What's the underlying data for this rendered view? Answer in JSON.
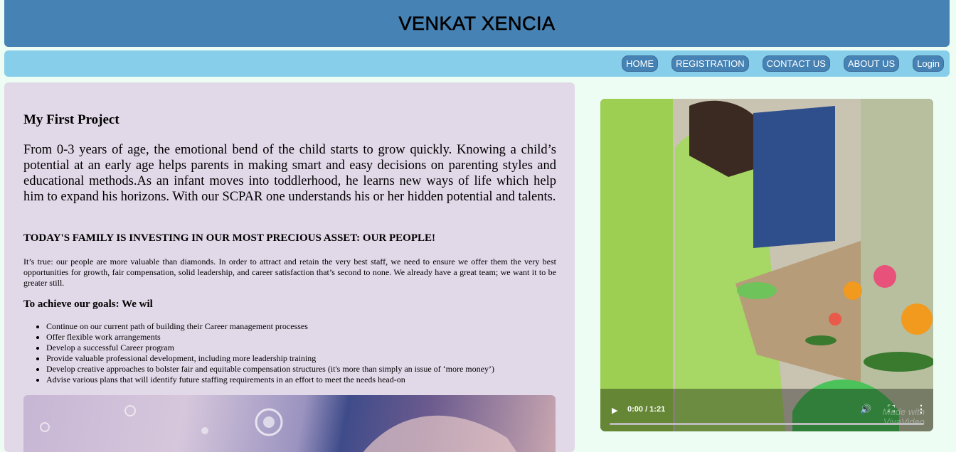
{
  "header": {
    "title": "VENKAT XENCIA"
  },
  "nav": {
    "items": [
      "HOME",
      "REGISTRATION",
      "CONTACT US",
      "ABOUT US",
      "Login"
    ]
  },
  "main": {
    "title": "My First Project",
    "intro": "From 0-3 years of age, the emotional bend of the child starts to grow quickly. Knowing a child’s potential at an early age helps parents in making smart and easy decisions on parenting styles and educational methods.As an infant moves into toddlerhood, he learns new ways of life which help him to expand his horizons. With our SCPAR one understands his or her hidden potential and talents.",
    "subheading": "TODAY'S FAMILY IS INVESTING IN OUR MOST PRECIOUS ASSET: OUR PEOPLE!",
    "paragraph": "It’s true: our people are more valuable than diamonds. In order to attract and retain the very best staff, we need to ensure we offer them the very best opportunities for growth, fair compensation, solid leadership, and career satisfaction that’s second to none. We already have a great team; we want it to be greater still.",
    "goals_heading": "To achieve our goals: We wil",
    "goals": [
      "Continue on our current path of building their Career management processes",
      "Offer flexible work arrangements",
      "Develop a successful Career program",
      "Provide valuable professional development, including more leadership training",
      "Develop creative approaches to bolster fair and equitable compensation structures (it's more than simply an issue of ‘more money’)",
      "Advise various plans that will identify future staffing requirements in an effort to meet the needs head-on"
    ]
  },
  "video": {
    "time": "0:00 / 1:21",
    "watermark_line1": "Made with",
    "watermark_line2": "VivaVideo",
    "icons": [
      "play-icon",
      "volume-icon",
      "fullscreen-icon",
      "more-options-icon"
    ]
  },
  "colors": {
    "header_bg": "#4682b4",
    "nav_bg": "#87ceeb",
    "nav_button_bg": "#4682b4",
    "content_bg": "#e1d8e8",
    "page_bg": "#eefdf3"
  }
}
